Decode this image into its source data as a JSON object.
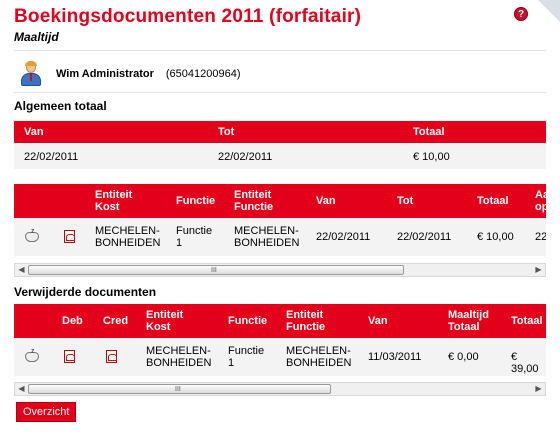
{
  "header": {
    "title": "Boekingsdocumenten 2011 (forfaitair)",
    "subtitle": "Maaltijd",
    "help_icon": "question-icon"
  },
  "user": {
    "name": "Wim Administrator",
    "id": "(65041200964)",
    "icon": "user-avatar-icon"
  },
  "totals": {
    "section_title": "Algemeen totaal",
    "headers": [
      "Van",
      "Tot",
      "Totaal"
    ],
    "row": [
      "22/02/2011",
      "22/02/2011",
      "€ 10,00"
    ]
  },
  "documents": {
    "headers": [
      "Entiteit Kost",
      "Functie",
      "Entiteit Functie",
      "Van",
      "Tot",
      "Totaal",
      "Aa op"
    ],
    "row": [
      "MECHELEN-BONHEIDEN",
      "Functie 1",
      "MECHELEN-BONHEIDEN",
      "22/02/2011",
      "22/02/2011",
      "€ 10,00",
      "22"
    ],
    "scroll_grip": "III"
  },
  "deleted": {
    "section_title": "Verwijderde documenten",
    "headers": [
      "Deb",
      "Cred",
      "Entiteit Kost",
      "Functie",
      "Entiteit Functie",
      "Van",
      "Maaltijd Totaal",
      "Totaal"
    ],
    "row": [
      "MECHELEN-BONHEIDEN",
      "Functie 1",
      "MECHELEN-BONHEIDEN",
      "11/03/2011",
      "€ 0,00",
      "€ 39,00"
    ],
    "scroll_grip": "III"
  },
  "buttons": {
    "overview": "Overzicht"
  },
  "colors": {
    "accent": "#e2001a",
    "row_bg": "#f3f3f3"
  }
}
